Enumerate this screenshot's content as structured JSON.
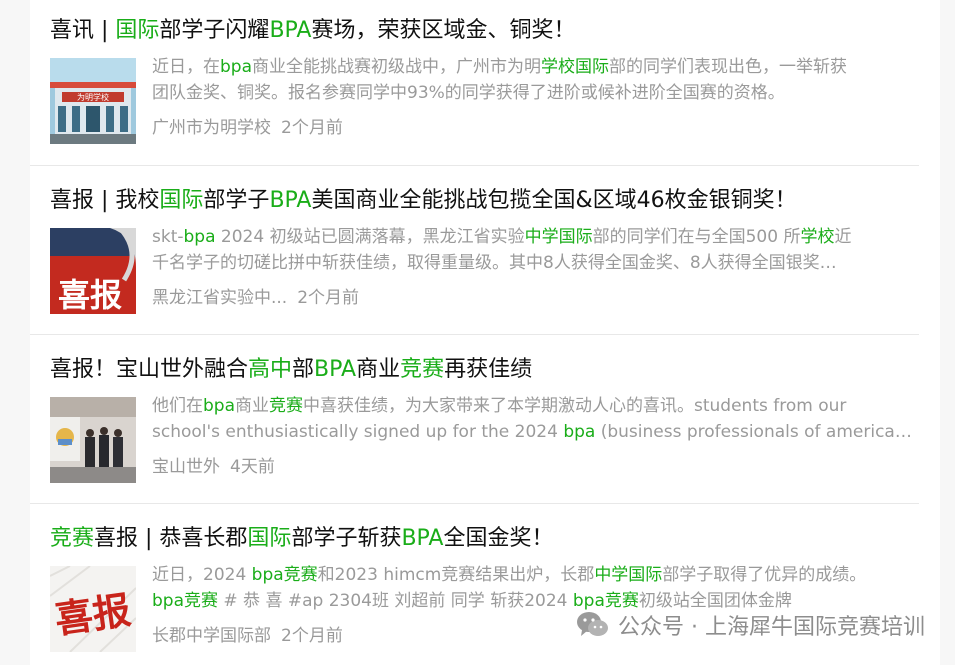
{
  "results": [
    {
      "title": [
        {
          "t": "喜讯 | "
        },
        {
          "t": "国际",
          "h": true
        },
        {
          "t": "部学子闪耀"
        },
        {
          "t": "BPA",
          "h": true
        },
        {
          "t": "赛场，荣获区域金、铜奖！"
        }
      ],
      "snippet_lines": [
        [
          {
            "t": "近日，在"
          },
          {
            "t": "bpa",
            "h": true
          },
          {
            "t": "商业全能挑战赛初级战中，广州市为明"
          },
          {
            "t": "学校国际",
            "h": true
          },
          {
            "t": "部的同学们表现出色，一举斩获"
          }
        ],
        [
          {
            "t": "团队金奖、铜奖。报名参赛同学中93%的同学获得了进阶或候补进阶全国赛的资格。"
          }
        ]
      ],
      "source": "广州市为明学校",
      "time": "2个月前",
      "thumb_text": "为明学校"
    },
    {
      "title": [
        {
          "t": "喜报 | 我校"
        },
        {
          "t": "国际",
          "h": true
        },
        {
          "t": "部学子"
        },
        {
          "t": "BPA",
          "h": true
        },
        {
          "t": "美国商业全能挑战包揽全国&区域46枚金银铜奖！"
        }
      ],
      "snippet_lines": [
        [
          {
            "t": "skt-"
          },
          {
            "t": "bpa",
            "h": true
          },
          {
            "t": " 2024 初级站已圆满落幕，黑龙江省实验"
          },
          {
            "t": "中学国际",
            "h": true
          },
          {
            "t": "部的同学们在与全国500 所"
          },
          {
            "t": "学校",
            "h": true
          },
          {
            "t": "近"
          }
        ],
        [
          {
            "t": "千名学子的切磋比拼中斩获佳绩，取得重量级。其中8人获得全国金奖、8人获得全国银奖…"
          }
        ]
      ],
      "source": "黑龙江省实验中...",
      "time": "2个月前",
      "thumb_text": "喜报"
    },
    {
      "title": [
        {
          "t": "喜报！宝山世外融合"
        },
        {
          "t": "高中",
          "h": true
        },
        {
          "t": "部"
        },
        {
          "t": "BPA",
          "h": true
        },
        {
          "t": "商业"
        },
        {
          "t": "竞赛",
          "h": true
        },
        {
          "t": "再获佳绩"
        }
      ],
      "snippet_lines": [
        [
          {
            "t": "他们在"
          },
          {
            "t": "bpa",
            "h": true
          },
          {
            "t": "商业"
          },
          {
            "t": "竞赛",
            "h": true
          },
          {
            "t": "中喜获佳绩，为大家带来了本学期激动人心的喜讯。students from our"
          }
        ],
        [
          {
            "t": "school's enthusiastically signed up for the 2024 "
          },
          {
            "t": "bpa",
            "h": true
          },
          {
            "t": "  (business professionals of america…"
          }
        ]
      ],
      "source": "宝山世外",
      "time": "4天前",
      "thumb_text": ""
    },
    {
      "title": [
        {
          "t": "竞赛",
          "h": true
        },
        {
          "t": "喜报 | 恭喜长郡"
        },
        {
          "t": "国际",
          "h": true
        },
        {
          "t": "部学子斩获"
        },
        {
          "t": "BPA",
          "h": true
        },
        {
          "t": "全国金奖！"
        }
      ],
      "snippet_lines": [
        [
          {
            "t": "近日，2024 "
          },
          {
            "t": "bpa竞赛",
            "h": true
          },
          {
            "t": "和2023 himcm竞赛结果出炉，长郡"
          },
          {
            "t": "中学国际",
            "h": true
          },
          {
            "t": "部学子取得了优异的成绩。"
          }
        ],
        [
          {
            "t": "bpa竞赛",
            "h": true
          },
          {
            "t": " # 恭 喜 #ap 2304班 刘超前 同学 斩获2024 "
          },
          {
            "t": "bpa竞赛",
            "h": true
          },
          {
            "t": "初级站全国团体金牌"
          }
        ]
      ],
      "source": "长郡中学国际部",
      "time": "2个月前",
      "thumb_text": "喜报"
    }
  ],
  "watermark": {
    "text": "公众号 · 上海犀牛国际竞赛培训",
    "icon": "wechat-icon"
  },
  "colors": {
    "highlight": "#1aad19",
    "title": "#111111",
    "muted": "#9a9a9a"
  }
}
